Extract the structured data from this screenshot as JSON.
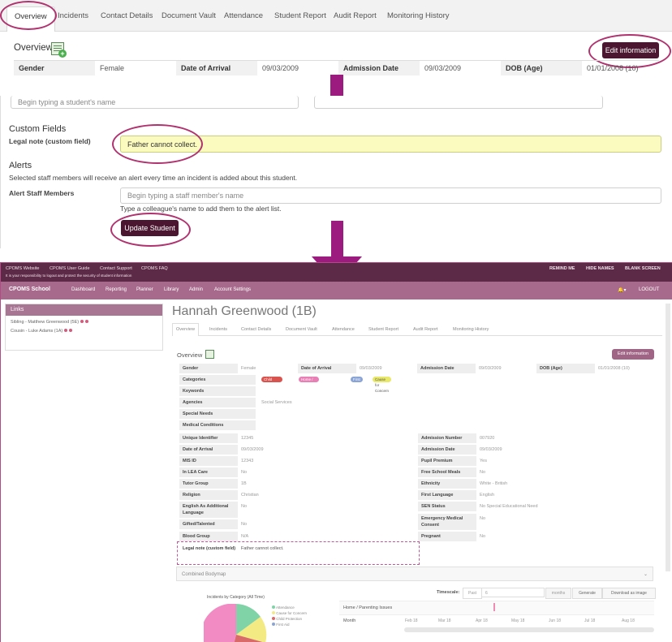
{
  "panel1": {
    "tabs": [
      "Overview",
      "Incidents",
      "Contact Details",
      "Document Vault",
      "Attendance",
      "Student Report",
      "Audit Report",
      "Monitoring History"
    ],
    "overview_title": "Overview",
    "edit_button": "Edit information",
    "row": [
      {
        "label": "Gender",
        "value": "Female"
      },
      {
        "label": "Date of Arrival",
        "value": "09/03/2009"
      },
      {
        "label": "Admission Date",
        "value": "09/03/2009"
      },
      {
        "label": "DOB (Age)",
        "value": "01/01/2008 (10)"
      }
    ]
  },
  "panel2": {
    "top_input_placeholder": "Begin typing a student's name",
    "custom_fields_heading": "Custom Fields",
    "legal_note_label": "Legal note (custom field)",
    "legal_note_value": "Father cannot collect.",
    "alerts_heading": "Alerts",
    "alerts_desc": "Selected staff members will receive an alert every time an incident is added about this student.",
    "alert_staff_label": "Alert Staff Members",
    "alert_staff_placeholder": "Begin typing a staff member's name",
    "alert_staff_help": "Type a colleague's name to add them to the alert list.",
    "update_button": "Update Student"
  },
  "panel3": {
    "topbar_links": [
      "CPOMS Website",
      "CPOMS User Guide",
      "Contact Support",
      "CPOMS FAQ"
    ],
    "topbar_note": "It is your responsibility to logout and protect the security of student information",
    "topbar_right": [
      "REMIND ME",
      "HIDE NAMES",
      "BLANK SCREEN"
    ],
    "brand": "CPOMS School",
    "nav": [
      "Dashboard",
      "Reporting",
      "Planner",
      "Library",
      "Admin",
      "Account Settings"
    ],
    "logout": "LOGOUT",
    "links_heading": "Links",
    "links": [
      "Sibling - Matthew Greenwood (5E)",
      "Cousin - Luke Adams (1A)"
    ],
    "student_name": "Hannah Greenwood (1B)",
    "tabs": [
      "Overview",
      "Incidents",
      "Contact Details",
      "Document Vault",
      "Attendance",
      "Student Report",
      "Audit Report",
      "Monitoring History"
    ],
    "overview_title": "Overview",
    "edit_button": "Edit information",
    "row1": [
      {
        "label": "Gender",
        "value": "Female"
      },
      {
        "label": "Date of Arrival",
        "value": "09/03/2009"
      },
      {
        "label": "Admission Date",
        "value": "09/03/2009"
      },
      {
        "label": "DOB (Age)",
        "value": "01/01/2008 (10)"
      }
    ],
    "categories_label": "Categories",
    "category_pills": [
      "Child Protection",
      "Home / Parenting Issues",
      "First Aid",
      "Cause for Concern"
    ],
    "keywords_label": "Keywords",
    "agencies_label": "Agencies",
    "agencies_value": "Social Services",
    "special_needs_label": "Special Needs",
    "medical_label": "Medical Conditions",
    "left_fields": [
      {
        "label": "Unique Identifier",
        "value": "12345"
      },
      {
        "label": "Date of Arrival",
        "value": "09/03/2009"
      },
      {
        "label": "MIS ID",
        "value": "12343"
      },
      {
        "label": "In LEA Care",
        "value": "No"
      },
      {
        "label": "Tutor Group",
        "value": "1B"
      },
      {
        "label": "Religion",
        "value": "Christian"
      },
      {
        "label": "English As Additional Language",
        "value": "No"
      },
      {
        "label": "Gifted/Talented",
        "value": "No"
      },
      {
        "label": "Blood Group",
        "value": "N/A"
      },
      {
        "label": "Legal note (custom field)",
        "value": "Father cannot collect."
      }
    ],
    "right_fields": [
      {
        "label": "Admission Number",
        "value": "007920"
      },
      {
        "label": "Admission Date",
        "value": "09/03/2009"
      },
      {
        "label": "Pupil Premium",
        "value": "Yes"
      },
      {
        "label": "Free School Meals",
        "value": "No"
      },
      {
        "label": "Ethnicity",
        "value": "White - British"
      },
      {
        "label": "First Language",
        "value": "English"
      },
      {
        "label": "SEN Status",
        "value": "No Special Educational Need"
      },
      {
        "label": "Emergency Medical Consent",
        "value": "No"
      },
      {
        "label": "Pregnant",
        "value": "No"
      }
    ],
    "bodymap_label": "Combined Bodymap",
    "pie_title": "Incidents by Category (All Time)",
    "pie_legend": [
      "Attendance",
      "Cause for Concern",
      "Child Protection",
      "First Aid"
    ],
    "timescale_label": "Timescale:",
    "timescale_unit_label": "Past",
    "timescale_value": "6",
    "timescale_period": "months",
    "generate_button": "Generate",
    "download_button": "Download as image",
    "timeline_row_label": "Home / Parenting Issues",
    "month_label": "Month",
    "months": [
      "Feb 18",
      "Mar 18",
      "Apr 18",
      "May 18",
      "Jun 18",
      "Jul 18",
      "Aug 18"
    ]
  }
}
